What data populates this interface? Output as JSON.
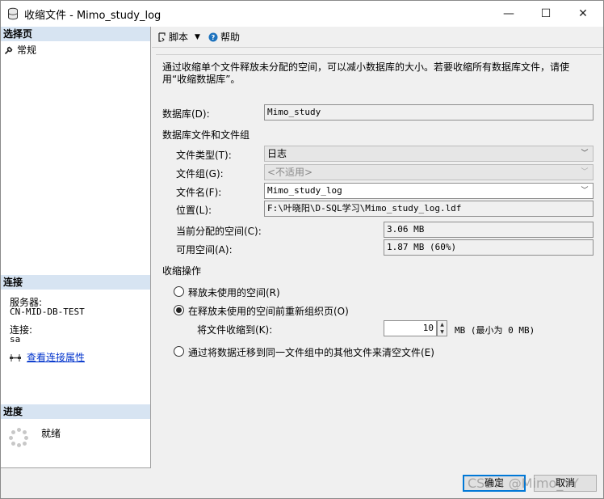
{
  "window": {
    "title": "收缩文件 - Mimo_study_log",
    "minimize_glyph": "—",
    "maximize_glyph": "☐",
    "close_glyph": "✕"
  },
  "sidebar": {
    "select_page_header": "选择页",
    "pages": [
      {
        "label": "常规",
        "icon": "wrench-icon"
      }
    ],
    "connection_header": "连接",
    "server_label": "服务器:",
    "server_value": "CN-MID-DB-TEST",
    "connection_label": "连接:",
    "connection_value": "sa",
    "view_connection_link": "查看连接属性",
    "progress_header": "进度",
    "progress_status": "就绪"
  },
  "toolbar": {
    "script_label": "脚本",
    "help_label": "帮助"
  },
  "form": {
    "description": "通过收缩单个文件释放未分配的空间，可以减小数据库的大小。若要收缩所有数据库文件，请使用“收缩数据库”。",
    "database_label": "数据库(D):",
    "database_value": "Mimo_study",
    "files_group_label": "数据库文件和文件组",
    "file_type_label": "文件类型(T):",
    "file_type_value": "日志",
    "filegroup_label": "文件组(G):",
    "filegroup_value": "<不适用>",
    "file_name_label": "文件名(F):",
    "file_name_value": "Mimo_study_log",
    "location_label": "位置(L):",
    "location_value": "F:\\叶晓阳\\D-SQL学习\\Mimo_study_log.ldf",
    "allocated_label": "当前分配的空间(C):",
    "allocated_value": "3.06 MB",
    "available_label": "可用空间(A):",
    "available_value": "1.87 MB (60%)",
    "shrink_action_label": "收缩操作",
    "option_release": "释放未使用的空间(R)",
    "option_reorganize": "在释放未使用的空间前重新组织页(O)",
    "shrink_to_label": "将文件收缩到(K):",
    "shrink_to_value": "10",
    "shrink_to_unit": "MB (最小为 0 MB)",
    "option_empty": "通过将数据迁移到同一文件组中的其他文件来清空文件(E)",
    "selected_option": "reorganize"
  },
  "buttons": {
    "ok": "确定",
    "cancel": "取消"
  },
  "watermark": "CSDN @Mimo_YY",
  "colors": {
    "section_header": "#d7e4f2",
    "link": "#0033cc",
    "default_button_border": "#0078d7"
  }
}
